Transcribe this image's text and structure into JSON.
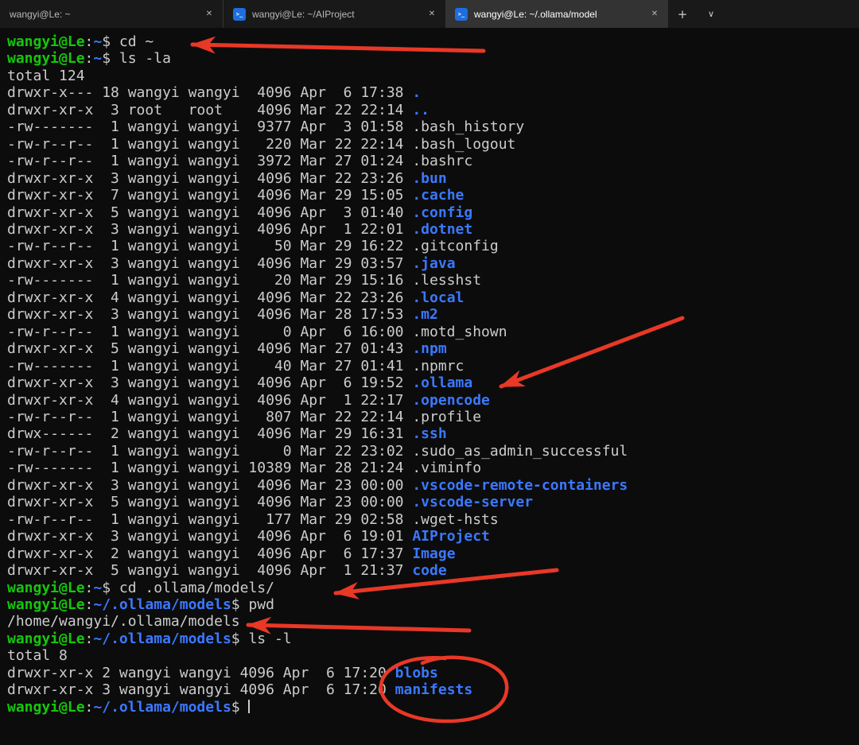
{
  "colors": {
    "bg": "#0c0c0c",
    "fg": "#cccccc",
    "green": "#16c60c",
    "blue": "#3b78ff",
    "annot": "#e93826"
  },
  "window": {
    "new_tab_label": "+",
    "dropdown_label": "∨",
    "close_label": "✕",
    "tabs": [
      {
        "title": "wangyi@Le: ~",
        "icon": "terminal",
        "active": false
      },
      {
        "title": "wangyi@Le: ~/AIProject",
        "icon": "linux-blue",
        "active": false
      },
      {
        "title": "wangyi@Le: ~/.ollama/model",
        "icon": "linux-blue",
        "active": true
      }
    ]
  },
  "terminal": {
    "cursor_visible": true,
    "lines": [
      [
        [
          "g",
          "wangyi@Le"
        ],
        [
          "w",
          ":"
        ],
        [
          "b",
          "~"
        ],
        [
          "w",
          "$ cd ~"
        ]
      ],
      [
        [
          "g",
          "wangyi@Le"
        ],
        [
          "w",
          ":"
        ],
        [
          "b",
          "~"
        ],
        [
          "w",
          "$ ls -la"
        ]
      ],
      [
        [
          "w",
          "total 124"
        ]
      ],
      [
        [
          "w",
          "drwxr-x--- 18 wangyi wangyi  4096 Apr  6 17:38 "
        ],
        [
          "b",
          "."
        ]
      ],
      [
        [
          "w",
          "drwxr-xr-x  3 root   root    4096 Mar 22 22:14 "
        ],
        [
          "b",
          ".."
        ]
      ],
      [
        [
          "w",
          "-rw-------  1 wangyi wangyi  9377 Apr  3 01:58 .bash_history"
        ]
      ],
      [
        [
          "w",
          "-rw-r--r--  1 wangyi wangyi   220 Mar 22 22:14 .bash_logout"
        ]
      ],
      [
        [
          "w",
          "-rw-r--r--  1 wangyi wangyi  3972 Mar 27 01:24 .bashrc"
        ]
      ],
      [
        [
          "w",
          "drwxr-xr-x  3 wangyi wangyi  4096 Mar 22 23:26 "
        ],
        [
          "b",
          ".bun"
        ]
      ],
      [
        [
          "w",
          "drwxr-xr-x  7 wangyi wangyi  4096 Mar 29 15:05 "
        ],
        [
          "b",
          ".cache"
        ]
      ],
      [
        [
          "w",
          "drwxr-xr-x  5 wangyi wangyi  4096 Apr  3 01:40 "
        ],
        [
          "b",
          ".config"
        ]
      ],
      [
        [
          "w",
          "drwxr-xr-x  3 wangyi wangyi  4096 Apr  1 22:01 "
        ],
        [
          "b",
          ".dotnet"
        ]
      ],
      [
        [
          "w",
          "-rw-r--r--  1 wangyi wangyi    50 Mar 29 16:22 .gitconfig"
        ]
      ],
      [
        [
          "w",
          "drwxr-xr-x  3 wangyi wangyi  4096 Mar 29 03:57 "
        ],
        [
          "b",
          ".java"
        ]
      ],
      [
        [
          "w",
          "-rw-------  1 wangyi wangyi    20 Mar 29 15:16 .lesshst"
        ]
      ],
      [
        [
          "w",
          "drwxr-xr-x  4 wangyi wangyi  4096 Mar 22 23:26 "
        ],
        [
          "b",
          ".local"
        ]
      ],
      [
        [
          "w",
          "drwxr-xr-x  3 wangyi wangyi  4096 Mar 28 17:53 "
        ],
        [
          "b",
          ".m2"
        ]
      ],
      [
        [
          "w",
          "-rw-r--r--  1 wangyi wangyi     0 Apr  6 16:00 .motd_shown"
        ]
      ],
      [
        [
          "w",
          "drwxr-xr-x  5 wangyi wangyi  4096 Mar 27 01:43 "
        ],
        [
          "b",
          ".npm"
        ]
      ],
      [
        [
          "w",
          "-rw-------  1 wangyi wangyi    40 Mar 27 01:41 .npmrc"
        ]
      ],
      [
        [
          "w",
          "drwxr-xr-x  3 wangyi wangyi  4096 Apr  6 19:52 "
        ],
        [
          "b",
          ".ollama"
        ]
      ],
      [
        [
          "w",
          "drwxr-xr-x  4 wangyi wangyi  4096 Apr  1 22:17 "
        ],
        [
          "b",
          ".opencode"
        ]
      ],
      [
        [
          "w",
          "-rw-r--r--  1 wangyi wangyi   807 Mar 22 22:14 .profile"
        ]
      ],
      [
        [
          "w",
          "drwx------  2 wangyi wangyi  4096 Mar 29 16:31 "
        ],
        [
          "b",
          ".ssh"
        ]
      ],
      [
        [
          "w",
          "-rw-r--r--  1 wangyi wangyi     0 Mar 22 23:02 .sudo_as_admin_successful"
        ]
      ],
      [
        [
          "w",
          "-rw-------  1 wangyi wangyi 10389 Mar 28 21:24 .viminfo"
        ]
      ],
      [
        [
          "w",
          "drwxr-xr-x  3 wangyi wangyi  4096 Mar 23 00:00 "
        ],
        [
          "b",
          ".vscode-remote-containers"
        ]
      ],
      [
        [
          "w",
          "drwxr-xr-x  5 wangyi wangyi  4096 Mar 23 00:00 "
        ],
        [
          "b",
          ".vscode-server"
        ]
      ],
      [
        [
          "w",
          "-rw-r--r--  1 wangyi wangyi   177 Mar 29 02:58 .wget-hsts"
        ]
      ],
      [
        [
          "w",
          "drwxr-xr-x  3 wangyi wangyi  4096 Apr  6 19:01 "
        ],
        [
          "b",
          "AIProject"
        ]
      ],
      [
        [
          "w",
          "drwxr-xr-x  2 wangyi wangyi  4096 Apr  6 17:37 "
        ],
        [
          "b",
          "Image"
        ]
      ],
      [
        [
          "w",
          "drwxr-xr-x  5 wangyi wangyi  4096 Apr  1 21:37 "
        ],
        [
          "b",
          "code"
        ]
      ],
      [
        [
          "g",
          "wangyi@Le"
        ],
        [
          "w",
          ":"
        ],
        [
          "b",
          "~"
        ],
        [
          "w",
          "$ cd .ollama/models/"
        ]
      ],
      [
        [
          "g",
          "wangyi@Le"
        ],
        [
          "w",
          ":"
        ],
        [
          "b",
          "~/.ollama/models"
        ],
        [
          "w",
          "$ pwd"
        ]
      ],
      [
        [
          "w",
          "/home/wangyi/.ollama/models"
        ]
      ],
      [
        [
          "g",
          "wangyi@Le"
        ],
        [
          "w",
          ":"
        ],
        [
          "b",
          "~/.ollama/models"
        ],
        [
          "w",
          "$ ls -l"
        ]
      ],
      [
        [
          "w",
          "total 8"
        ]
      ],
      [
        [
          "w",
          "drwxr-xr-x 2 wangyi wangyi 4096 Apr  6 17:20 "
        ],
        [
          "b",
          "blobs"
        ]
      ],
      [
        [
          "w",
          "drwxr-xr-x 3 wangyi wangyi 4096 Apr  6 17:20 "
        ],
        [
          "b",
          "manifests"
        ]
      ],
      [
        [
          "g",
          "wangyi@Le"
        ],
        [
          "w",
          ":"
        ],
        [
          "b",
          "~/.ollama/models"
        ],
        [
          "w",
          "$ "
        ]
      ]
    ]
  }
}
